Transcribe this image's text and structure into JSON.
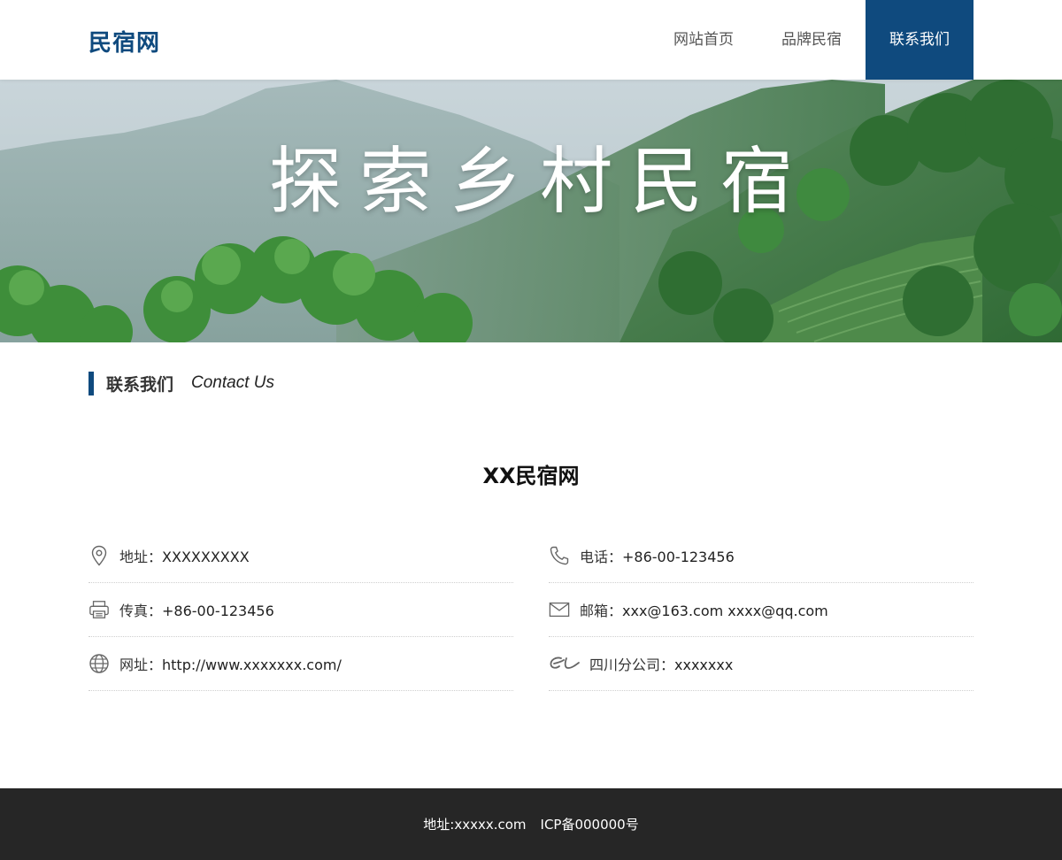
{
  "header": {
    "logo": "民宿网",
    "nav": [
      {
        "label": "网站首页"
      },
      {
        "label": "品牌民宿"
      },
      {
        "label": "联系我们"
      }
    ]
  },
  "banner": {
    "title": "探索乡村民宿"
  },
  "section": {
    "title_cn": "联系我们",
    "title_en": "Contact Us"
  },
  "company": {
    "name": "XX民宿网"
  },
  "contacts": {
    "address": {
      "label": "地址：",
      "value": "XXXXXXXXX"
    },
    "phone": {
      "label": "电话：",
      "value": "+86-00-123456"
    },
    "fax": {
      "label": "传真：",
      "value": "+86-00-123456"
    },
    "email": {
      "label": "邮箱：",
      "value": "xxx@163.com xxxx@qq.com"
    },
    "website": {
      "label": "网址：",
      "value": "http://www.xxxxxxx.com/"
    },
    "branch": {
      "label": "四川分公司：",
      "value": "xxxxxxx"
    }
  },
  "footer": {
    "address": "地址:xxxxx.com",
    "icp": "ICP备000000号"
  },
  "icons": [
    "location-icon",
    "phone-icon",
    "fax-icon",
    "mail-icon",
    "globe-icon",
    "alibaba-icon"
  ],
  "colors": {
    "brand": "#0f4a7e",
    "footer": "#262626"
  }
}
